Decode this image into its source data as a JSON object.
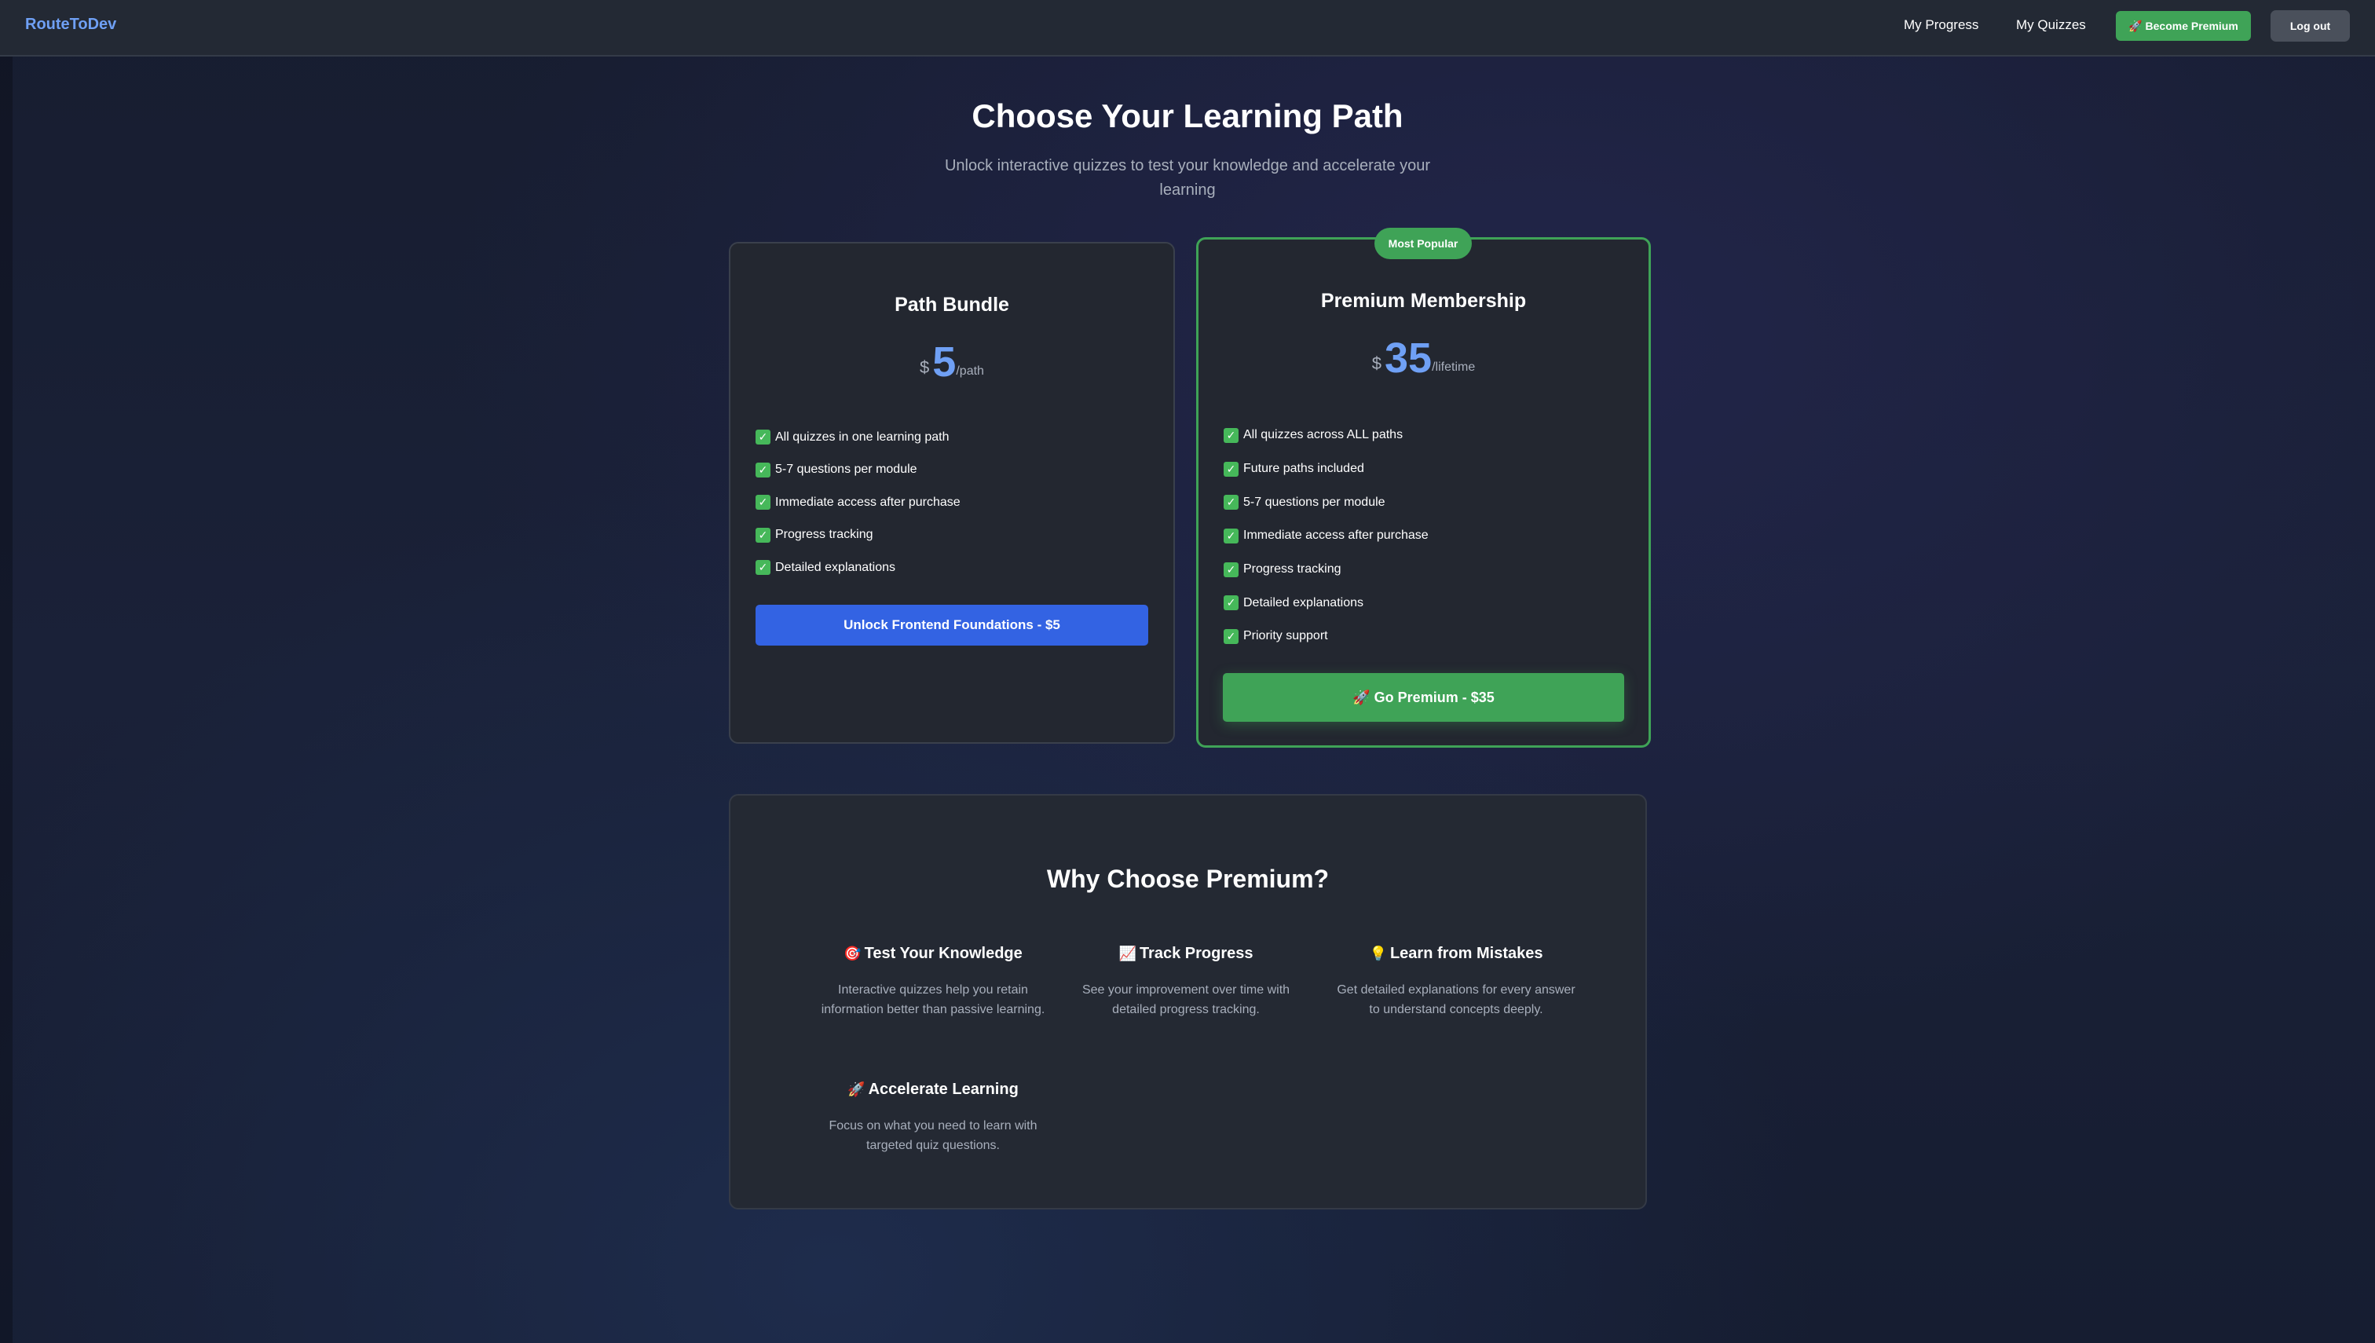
{
  "nav": {
    "logo": "RouteToDev",
    "my_progress": "My Progress",
    "my_quizzes": "My Quizzes",
    "become_premium": "🚀 Become Premium",
    "logout": "Log out"
  },
  "header": {
    "title": "Choose Your Learning Path",
    "subtitle": "Unlock interactive quizzes to test your knowledge and accelerate your learning"
  },
  "plans": {
    "path_bundle": {
      "title": "Path Bundle",
      "currency": "$",
      "amount": "5",
      "period": "/path",
      "features": [
        "All quizzes in one learning path",
        "5-7 questions per module",
        "Immediate access after purchase",
        "Progress tracking",
        "Detailed explanations"
      ],
      "cta": "Unlock Frontend Foundations - $5"
    },
    "premium": {
      "badge": "Most Popular",
      "title": "Premium Membership",
      "currency": "$",
      "amount": "35",
      "period": "/lifetime",
      "features": [
        "All quizzes across ALL paths",
        "Future paths included",
        "5-7 questions per module",
        "Immediate access after purchase",
        "Progress tracking",
        "Detailed explanations",
        "Priority support"
      ],
      "cta": "🚀 Go Premium - $35"
    }
  },
  "why": {
    "title": "Why Choose Premium?",
    "benefits": [
      {
        "icon": "🎯",
        "icon_name": "target-icon",
        "title": "Test Your Knowledge",
        "desc": "Interactive quizzes help you retain information better than passive learning."
      },
      {
        "icon": "📈",
        "icon_name": "chart-increasing-icon",
        "title": "Track Progress",
        "desc": "See your improvement over time with detailed progress tracking."
      },
      {
        "icon": "💡",
        "icon_name": "light-bulb-icon",
        "title": "Learn from Mistakes",
        "desc": "Get detailed explanations for every answer to understand concepts deeply."
      },
      {
        "icon": "🚀",
        "icon_name": "rocket-icon",
        "title": "Accelerate Learning",
        "desc": "Focus on what you need to learn with targeted quiz questions."
      }
    ]
  },
  "colors": {
    "accent_blue": "#6fa0f5",
    "cta_blue": "#3363e3",
    "premium_green": "#3fa357",
    "card_bg": "#232730",
    "check_green": "#46b85a"
  }
}
